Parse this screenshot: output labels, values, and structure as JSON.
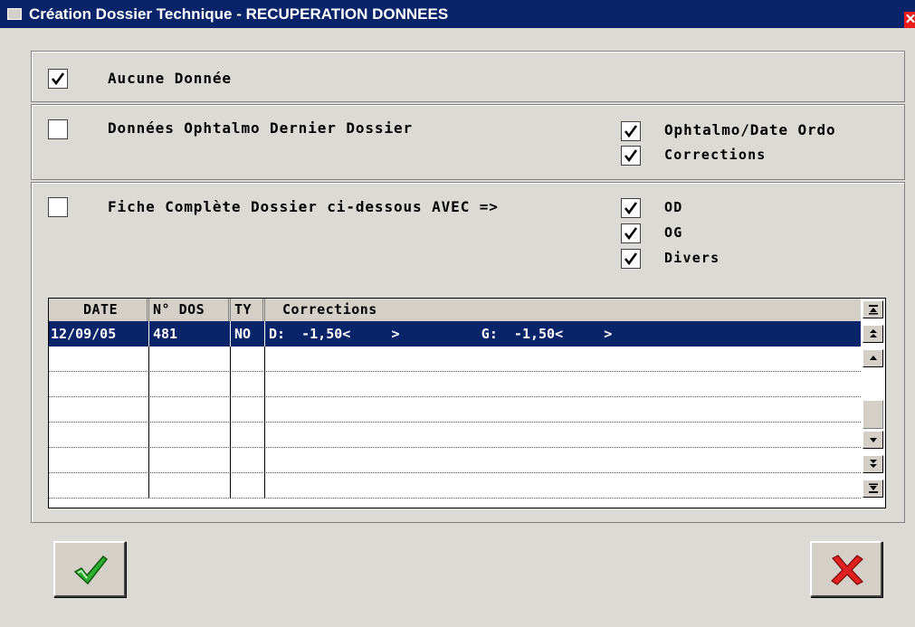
{
  "window": {
    "title": "Création Dossier Technique - RECUPERATION DONNEES",
    "close_symbol": "✕"
  },
  "options": {
    "aucune_donnee": {
      "label": "Aucune Donnée",
      "checked": true
    },
    "dernier_dossier": {
      "label": "Données Ophtalmo Dernier Dossier",
      "checked": false,
      "sub": [
        {
          "label": "Ophtalmo/Date Ordo",
          "checked": true
        },
        {
          "label": "Corrections",
          "checked": true
        }
      ]
    },
    "fiche_complete": {
      "label": "Fiche Complète Dossier ci-dessous AVEC =>",
      "checked": false,
      "sub": [
        {
          "label": "OD",
          "checked": true
        },
        {
          "label": "OG",
          "checked": true
        },
        {
          "label": "Divers",
          "checked": true
        }
      ]
    }
  },
  "table": {
    "columns": [
      "DATE",
      "N° DOS",
      "TY",
      "Corrections"
    ],
    "rows": [
      {
        "date": "12/09/05",
        "dos": "481",
        "ty": "NO",
        "corrections": "D:  -1,50<     >          G:  -1,50<     >"
      },
      {
        "date": "",
        "dos": "",
        "ty": "",
        "corrections": ""
      },
      {
        "date": "",
        "dos": "",
        "ty": "",
        "corrections": ""
      },
      {
        "date": "",
        "dos": "",
        "ty": "",
        "corrections": ""
      },
      {
        "date": "",
        "dos": "",
        "ty": "",
        "corrections": ""
      },
      {
        "date": "",
        "dos": "",
        "ty": "",
        "corrections": ""
      },
      {
        "date": "",
        "dos": "",
        "ty": "",
        "corrections": ""
      }
    ],
    "selected_row": 0
  },
  "colors": {
    "title_bar": "#0a246a",
    "selection": "#0a246a",
    "ok_check": "#2fae2f",
    "cancel_cross": "#e02020"
  },
  "icons": {
    "ok": "green-checkmark-icon",
    "cancel": "red-x-icon"
  }
}
